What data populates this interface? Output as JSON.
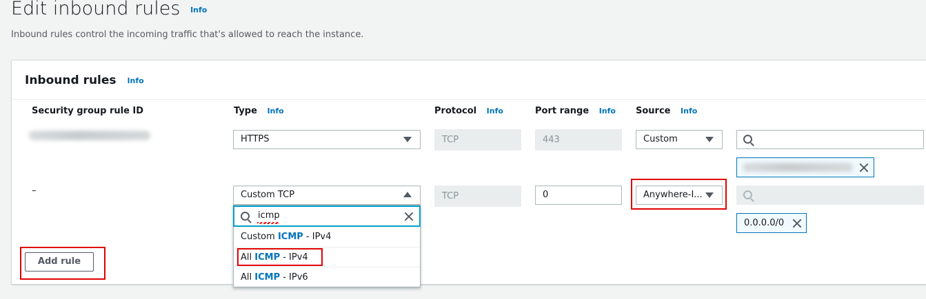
{
  "header": {
    "title": "Edit inbound rules",
    "info": "Info",
    "description": "Inbound rules control the incoming traffic that's allowed to reach the instance."
  },
  "panel": {
    "title": "Inbound rules",
    "info": "Info"
  },
  "columns": {
    "rule_id": "Security group rule ID",
    "type": "Type",
    "protocol": "Protocol",
    "port_range": "Port range",
    "source": "Source",
    "info": "Info"
  },
  "rows": [
    {
      "rule_id": "",
      "type": "HTTPS",
      "protocol": "TCP",
      "port_range": "443",
      "source_type": "Custom",
      "source_search_placeholder": "",
      "source_token": ""
    },
    {
      "rule_id": "–",
      "type": "Custom TCP",
      "protocol": "TCP",
      "port_range": "0",
      "source_type": "Anywhere-I...",
      "source_search_placeholder": "",
      "source_token": "0.0.0.0/0"
    }
  ],
  "type_dropdown": {
    "search_value": "icmp",
    "options": [
      {
        "prefix": "Custom ",
        "match": "ICMP",
        "suffix": " - IPv4"
      },
      {
        "prefix": "All ",
        "match": "ICMP",
        "suffix": " - IPv4"
      },
      {
        "prefix": "All ",
        "match": "ICMP",
        "suffix": " - IPv6"
      }
    ]
  },
  "actions": {
    "add_rule": "Add rule"
  },
  "colors": {
    "link": "#0073bb",
    "focus": "#00a1c9",
    "highlight": "#e00000"
  }
}
